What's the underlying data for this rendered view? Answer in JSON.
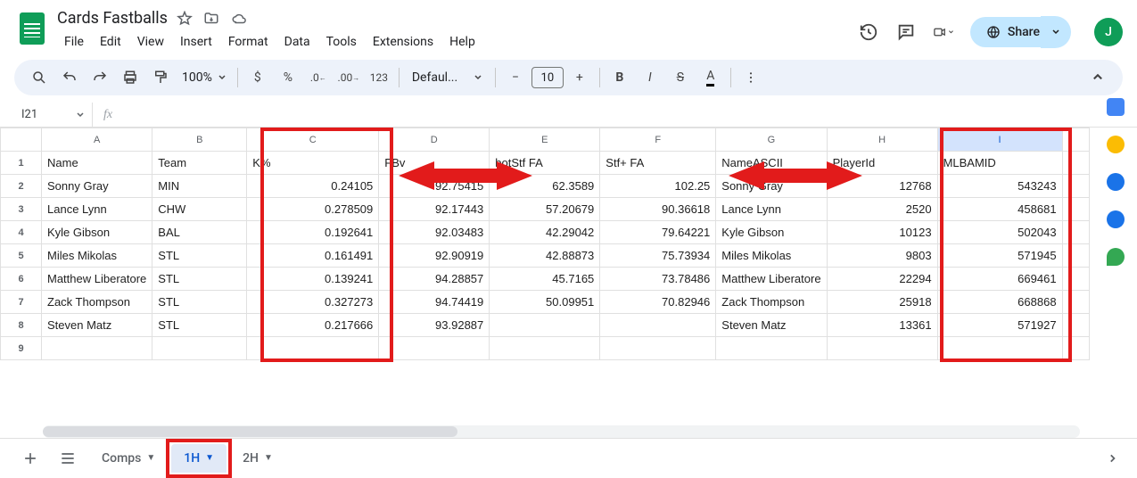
{
  "doc_title": "Cards Fastballs",
  "menu": [
    "File",
    "Edit",
    "View",
    "Insert",
    "Format",
    "Data",
    "Tools",
    "Extensions",
    "Help"
  ],
  "toolbar": {
    "zoom": "100%",
    "font": "Defaul...",
    "font_size": "10"
  },
  "name_box": "I21",
  "share_label": "Share",
  "avatar_initial": "J",
  "columns": [
    "A",
    "B",
    "C",
    "D",
    "E",
    "F",
    "G",
    "H",
    "I"
  ],
  "selected_col_index": 8,
  "headers": [
    "Name",
    "Team",
    "K%",
    "FBv",
    "botStf FA",
    "Stf+ FA",
    "NameASCII",
    "PlayerId",
    "MLBAMID"
  ],
  "rows": [
    {
      "name": "Sonny Gray",
      "team": "MIN",
      "k": "0.24105",
      "fbv": "92.75415",
      "bot": "62.3589",
      "stf": "102.25",
      "ascii": "Sonny Gray",
      "pid": "12768",
      "mlb": "543243"
    },
    {
      "name": "Lance Lynn",
      "team": "CHW",
      "k": "0.278509",
      "fbv": "92.17443",
      "bot": "57.20679",
      "stf": "90.36618",
      "ascii": "Lance Lynn",
      "pid": "2520",
      "mlb": "458681"
    },
    {
      "name": "Kyle Gibson",
      "team": "BAL",
      "k": "0.192641",
      "fbv": "92.03483",
      "bot": "42.29042",
      "stf": "79.64221",
      "ascii": "Kyle Gibson",
      "pid": "10123",
      "mlb": "502043"
    },
    {
      "name": "Miles Mikolas",
      "team": "STL",
      "k": "0.161491",
      "fbv": "92.90919",
      "bot": "42.88873",
      "stf": "75.73934",
      "ascii": "Miles Mikolas",
      "pid": "9803",
      "mlb": "571945"
    },
    {
      "name": "Matthew Liberatore",
      "team": "STL",
      "k": "0.139241",
      "fbv": "94.28857",
      "bot": "45.7165",
      "stf": "73.78486",
      "ascii": "Matthew Liberatore",
      "pid": "22294",
      "mlb": "669461"
    },
    {
      "name": "Zack Thompson",
      "team": "STL",
      "k": "0.327273",
      "fbv": "94.74419",
      "bot": "50.09951",
      "stf": "70.82946",
      "ascii": "Zack Thompson",
      "pid": "25918",
      "mlb": "668868"
    },
    {
      "name": "Steven Matz",
      "team": "STL",
      "k": "0.217666",
      "fbv": "93.92887",
      "bot": "",
      "stf": "",
      "ascii": "Steven Matz",
      "pid": "13361",
      "mlb": "571927"
    }
  ],
  "sheet_tabs": [
    {
      "label": "Comps",
      "active": false
    },
    {
      "label": "1H",
      "active": true
    },
    {
      "label": "2H",
      "active": false
    }
  ]
}
